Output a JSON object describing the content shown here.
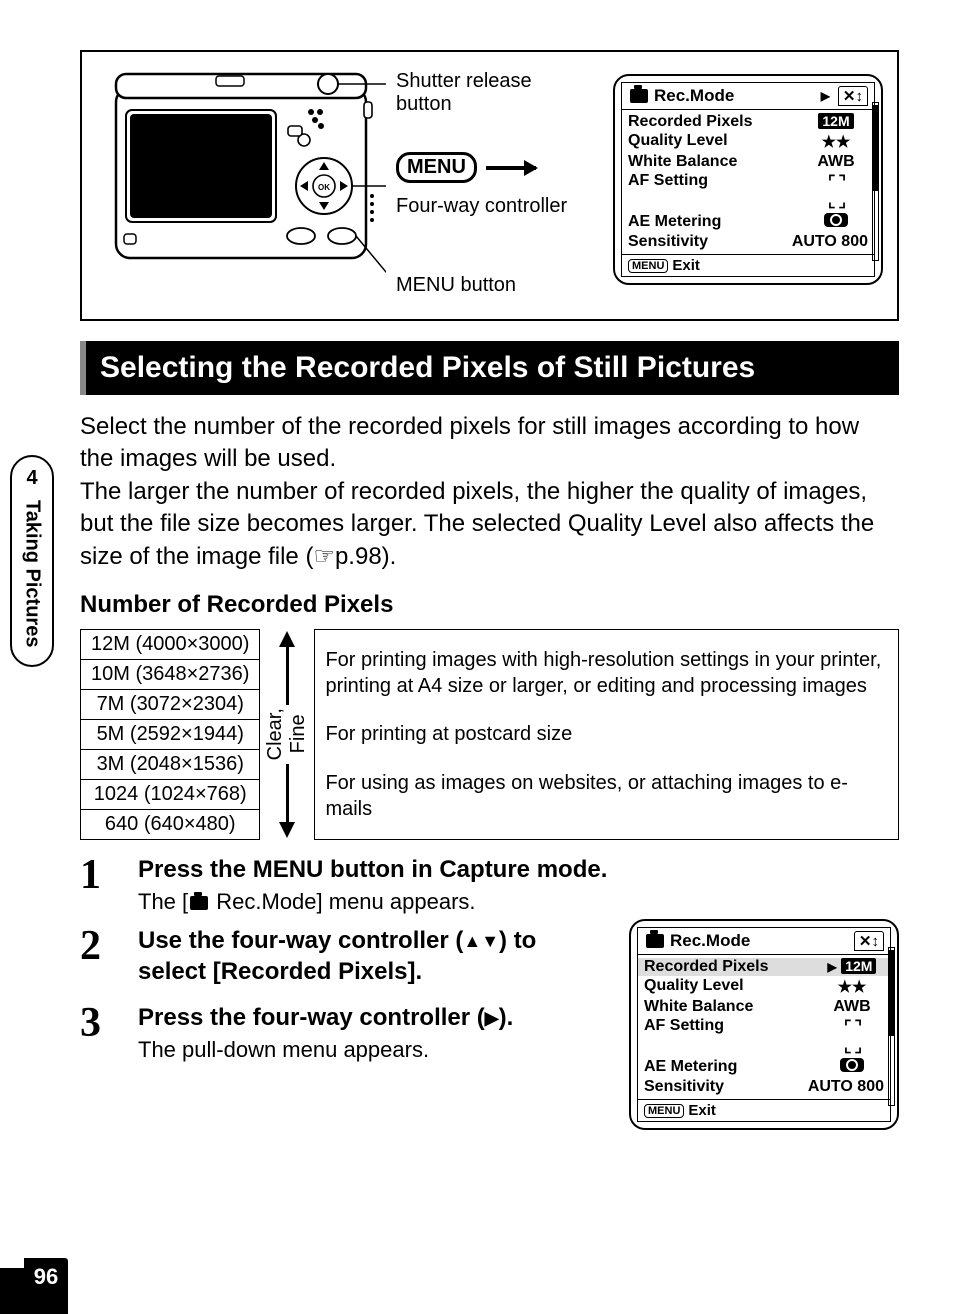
{
  "side_tab": {
    "number": "4",
    "section": "Taking Pictures"
  },
  "page_number": "96",
  "top_labels": {
    "shutter": "Shutter release button",
    "four_way": "Four-way controller",
    "menu_chip": "MENU",
    "menu_btn": "MENU button"
  },
  "lcd1": {
    "title": "Rec.Mode",
    "rows": [
      {
        "label": "Recorded Pixels",
        "val": "12M",
        "inv": true
      },
      {
        "label": "Quality Level",
        "val": "★★"
      },
      {
        "label": "White Balance",
        "val": "AWB"
      },
      {
        "label": "AF Setting",
        "val": "af"
      },
      {
        "label": "AE Metering",
        "val": "ae"
      },
      {
        "label": "Sensitivity",
        "val": "AUTO 800"
      }
    ],
    "exit": "Exit",
    "menu": "MENU"
  },
  "heading": "Selecting the Recorded Pixels of Still Pictures",
  "intro": "Select the number of the recorded pixels for still images according to how the images will be used.\nThe larger the number of recorded pixels, the higher the quality of images, but the file size becomes larger. The selected Quality Level also affects the size of the image file (☞p.98).",
  "subheading": "Number of Recorded Pixels",
  "pixel_rows": [
    "12M (4000×3000)",
    "10M (3648×2736)",
    "7M (3072×2304)",
    "5M (2592×1944)",
    "3M (2048×1536)",
    "1024 (1024×768)",
    "640 (640×480)"
  ],
  "arrow_label": "Clear, Fine",
  "desc": {
    "top": "For printing images with high-resolution settings in your printer, printing at A4 size or larger, or editing and processing images",
    "mid": "For printing at postcard size",
    "bot": "For using as images on websites, or attaching images to e-mails"
  },
  "steps": [
    {
      "n": "1",
      "title": "Press the MENU button in Capture mode.",
      "note": "The [📷 Rec.Mode] menu appears."
    },
    {
      "n": "2",
      "title": "Use the four-way controller (▲▼) to select [Recorded Pixels]."
    },
    {
      "n": "3",
      "title": "Press the four-way controller (▶).",
      "note": "The pull-down menu appears."
    }
  ],
  "lcd2": {
    "title": "Rec.Mode",
    "rows": [
      {
        "label": "Recorded Pixels",
        "val": "12M",
        "inv": true,
        "sel": true
      },
      {
        "label": "Quality Level",
        "val": "★★"
      },
      {
        "label": "White Balance",
        "val": "AWB"
      },
      {
        "label": "AF Setting",
        "val": "af"
      },
      {
        "label": "AE Metering",
        "val": "ae"
      },
      {
        "label": "Sensitivity",
        "val": "AUTO 800"
      }
    ],
    "exit": "Exit",
    "menu": "MENU"
  }
}
